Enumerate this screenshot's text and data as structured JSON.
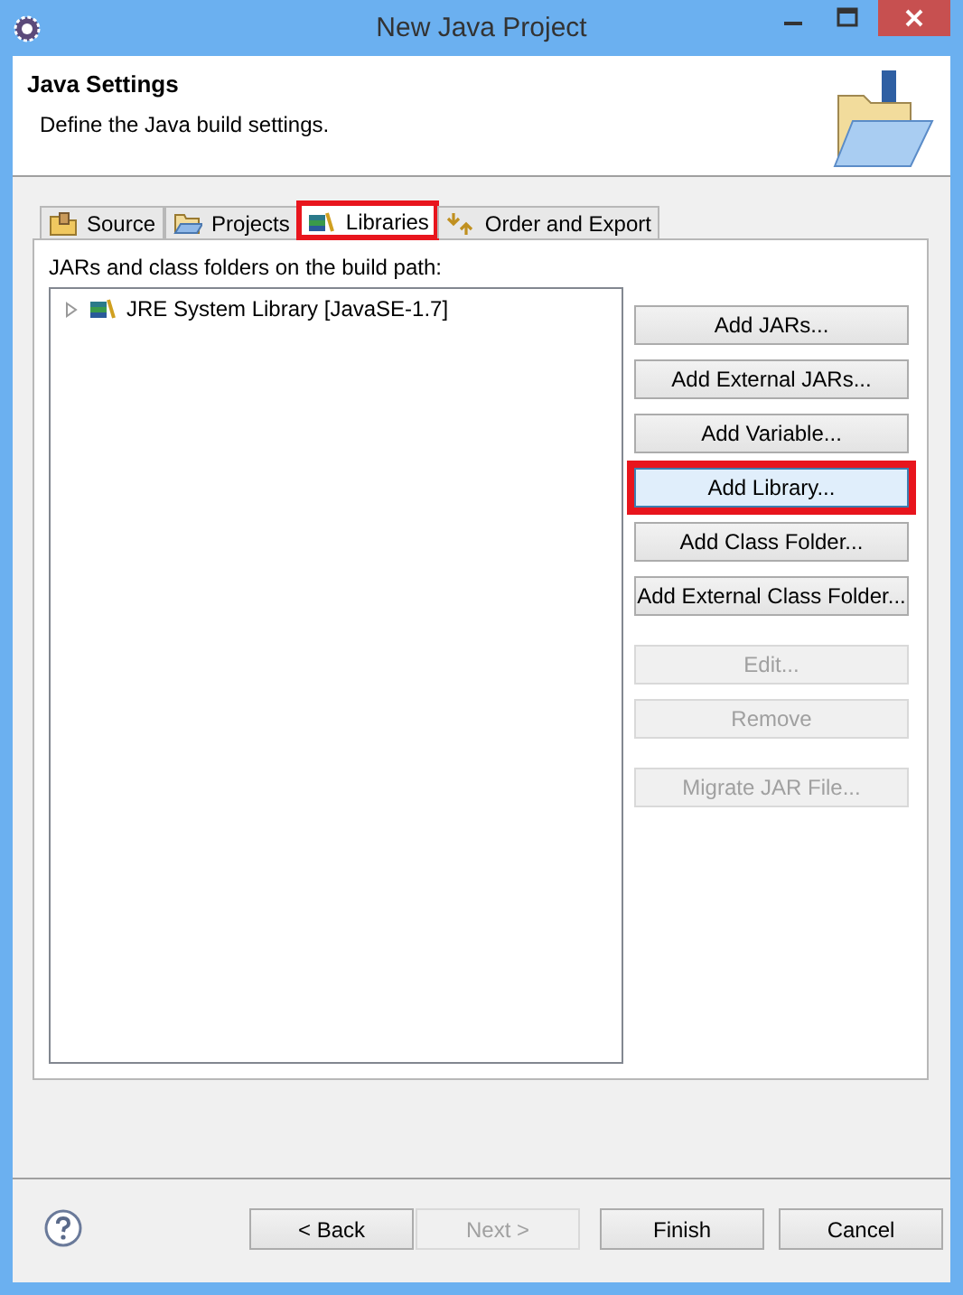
{
  "window": {
    "title": "New Java Project"
  },
  "header": {
    "title": "Java Settings",
    "description": "Define the Java build settings."
  },
  "tabs": [
    {
      "label": "Source",
      "kind": "source",
      "selected": false,
      "highlighted": false
    },
    {
      "label": "Projects",
      "kind": "projects",
      "selected": false,
      "highlighted": false
    },
    {
      "label": "Libraries",
      "kind": "libraries",
      "selected": true,
      "highlighted": true
    },
    {
      "label": "Order and Export",
      "kind": "order",
      "selected": false,
      "highlighted": false
    }
  ],
  "build_path": {
    "label": "JARs and class folders on the build path:",
    "items": [
      {
        "label": "JRE System Library [JavaSE-1.7]",
        "expanded": false
      }
    ]
  },
  "button_groups": [
    {
      "buttons": [
        {
          "label": "Add JARs...",
          "disabled": false,
          "highlighted": false
        },
        {
          "label": "Add External JARs...",
          "disabled": false,
          "highlighted": false
        },
        {
          "label": "Add Variable...",
          "disabled": false,
          "highlighted": false
        },
        {
          "label": "Add Library...",
          "disabled": false,
          "highlighted": true
        },
        {
          "label": "Add Class Folder...",
          "disabled": false,
          "highlighted": false
        },
        {
          "label": "Add External Class Folder...",
          "disabled": false,
          "highlighted": false
        }
      ]
    },
    {
      "buttons": [
        {
          "label": "Edit...",
          "disabled": true,
          "highlighted": false
        },
        {
          "label": "Remove",
          "disabled": true,
          "highlighted": false
        }
      ]
    },
    {
      "buttons": [
        {
          "label": "Migrate JAR File...",
          "disabled": true,
          "highlighted": false
        }
      ]
    }
  ],
  "footer_buttons": [
    {
      "label": "< Back",
      "disabled": false
    },
    {
      "label": "Next >",
      "disabled": true
    },
    {
      "label": "Finish",
      "disabled": false
    },
    {
      "label": "Cancel",
      "disabled": false
    }
  ]
}
